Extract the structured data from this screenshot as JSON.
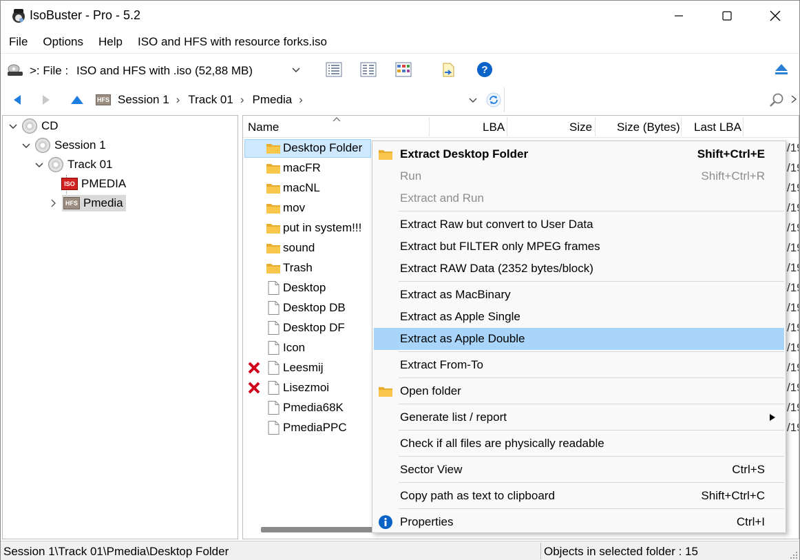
{
  "window": {
    "title": "IsoBuster - Pro - 5.2"
  },
  "menu": [
    "File",
    "Options",
    "Help",
    "ISO and HFS with resource forks.iso"
  ],
  "toolbar": {
    "drive_prefix": ">: File :",
    "drive_value": "ISO and HFS with .iso  (52,88 MB)"
  },
  "address": {
    "crumbs": [
      "Session 1",
      "Track 01",
      "Pmedia"
    ],
    "hfs_badge": "HFS"
  },
  "tree": {
    "nodes": [
      {
        "label": "CD"
      },
      {
        "label": "Session 1"
      },
      {
        "label": "Track 01"
      },
      {
        "label": "PMEDIA",
        "badge": "ISO"
      },
      {
        "label": "Pmedia",
        "badge": "HFS"
      }
    ]
  },
  "list": {
    "columns": [
      "Name",
      "LBA",
      "Size",
      "Size (Bytes)",
      "Last LBA"
    ],
    "rows": [
      {
        "name": "Desktop Folder",
        "type": "folder",
        "tail": "/19"
      },
      {
        "name": "macFR",
        "type": "folder",
        "tail": "/19"
      },
      {
        "name": "macNL",
        "type": "folder",
        "tail": "/19"
      },
      {
        "name": "mov",
        "type": "folder",
        "tail": "/19"
      },
      {
        "name": "put in system!!!",
        "type": "folder",
        "tail": "/19"
      },
      {
        "name": "sound",
        "type": "folder",
        "tail": "/19"
      },
      {
        "name": "Trash",
        "type": "folder",
        "tail": "/19"
      },
      {
        "name": "Desktop",
        "type": "file",
        "tail": "/19"
      },
      {
        "name": "Desktop DB",
        "type": "file",
        "tail": "/19"
      },
      {
        "name": "Desktop DF",
        "type": "file",
        "tail": "/19"
      },
      {
        "name": "Icon",
        "type": "file",
        "tail": "/19"
      },
      {
        "name": "Leesmij",
        "type": "file",
        "tail": "/19",
        "error": true
      },
      {
        "name": "Lisezmoi",
        "type": "file",
        "tail": "/19",
        "error": true
      },
      {
        "name": "Pmedia68K",
        "type": "file",
        "tail": "/19"
      },
      {
        "name": "PmediaPPC",
        "type": "file",
        "tail": "/19"
      }
    ]
  },
  "context_menu": {
    "items": [
      {
        "label": "Extract Desktop Folder",
        "shortcut": "Shift+Ctrl+E",
        "bold": true,
        "icon": "folder-icon"
      },
      {
        "label": "Run",
        "shortcut": "Shift+Ctrl+R",
        "disabled": true
      },
      {
        "label": "Extract and Run",
        "shortcut": "",
        "disabled": true
      },
      {
        "label": "Extract Raw but convert to User Data",
        "shortcut": ""
      },
      {
        "label": "Extract but FILTER only MPEG frames",
        "shortcut": ""
      },
      {
        "label": "Extract RAW Data (2352 bytes/block)",
        "shortcut": ""
      },
      {
        "label": "Extract as MacBinary",
        "shortcut": ""
      },
      {
        "label": "Extract as Apple Single",
        "shortcut": ""
      },
      {
        "label": "Extract as Apple Double",
        "shortcut": "",
        "highlighted": true
      },
      {
        "label": "Extract From-To",
        "shortcut": ""
      },
      {
        "label": "Open folder",
        "shortcut": "",
        "icon": "folder-icon"
      },
      {
        "label": "Generate list / report",
        "shortcut": "",
        "submenu": true
      },
      {
        "label": "Check if all files are physically readable",
        "shortcut": ""
      },
      {
        "label": "Sector View",
        "shortcut": "Ctrl+S"
      },
      {
        "label": "Copy path as text to clipboard",
        "shortcut": "Shift+Ctrl+C"
      },
      {
        "label": "Properties",
        "shortcut": "Ctrl+I",
        "icon": "info-icon"
      }
    ]
  },
  "status": {
    "left": "Session 1\\Track 01\\Pmedia\\Desktop Folder",
    "right": "Objects in selected folder : 15"
  },
  "colors": {
    "accent": "#0067c0",
    "selection": "#cde8ff",
    "menu_highlight": "#a9d5fb",
    "folder": "#f8c64a",
    "error": "#d0021b"
  }
}
